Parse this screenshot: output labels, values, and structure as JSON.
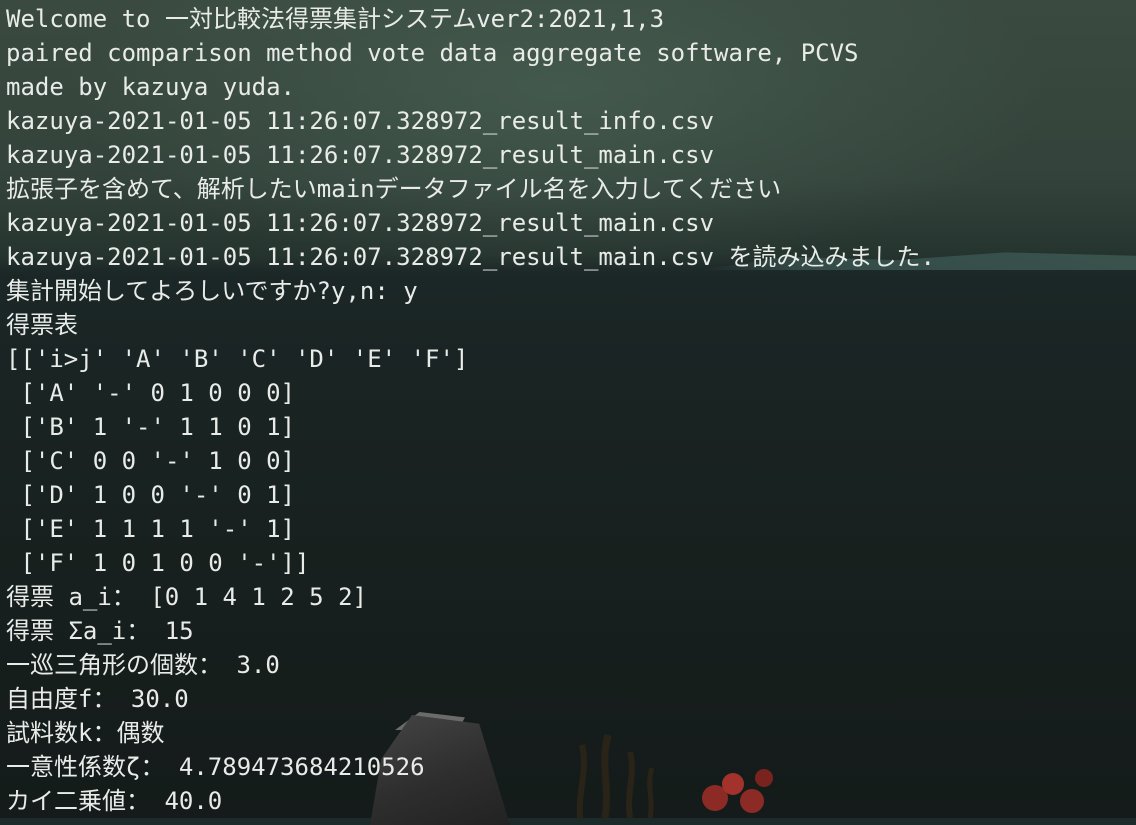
{
  "terminal": {
    "lines": [
      "Welcome to 一対比較法得票集計システムver2:2021,1,3",
      "paired comparison method vote data aggregate software, PCVS",
      "made by kazuya yuda.",
      "kazuya-2021-01-05 11:26:07.328972_result_info.csv",
      "kazuya-2021-01-05 11:26:07.328972_result_main.csv",
      "拡張子を含めて、解析したいmainデータファイル名を入力してください",
      "kazuya-2021-01-05 11:26:07.328972_result_main.csv",
      "kazuya-2021-01-05 11:26:07.328972_result_main.csv を読み込みました.",
      "集計開始してよろしいですか?y,n: y",
      "得票表",
      "[['i>j' 'A' 'B' 'C' 'D' 'E' 'F']",
      " ['A' '-' 0 1 0 0 0]",
      " ['B' 1 '-' 1 1 0 1]",
      " ['C' 0 0 '-' 1 0 0]",
      " ['D' 1 0 0 '-' 0 1]",
      " ['E' 1 1 1 1 '-' 1]",
      " ['F' 1 0 1 0 0 '-']]",
      "得票 a_i： [0 1 4 1 2 5 2]",
      "得票 Σa_i： 15",
      "一巡三角形の個数： 3.0",
      "自由度f： 30.0",
      "試料数k：偶数",
      "一意性係数ζ： 4.789473684210526",
      "カイ二乗値： 40.0"
    ]
  },
  "colors": {
    "text": "#e8ebe8",
    "background_top": "#3a4a40",
    "background_bottom": "#141b1a"
  }
}
